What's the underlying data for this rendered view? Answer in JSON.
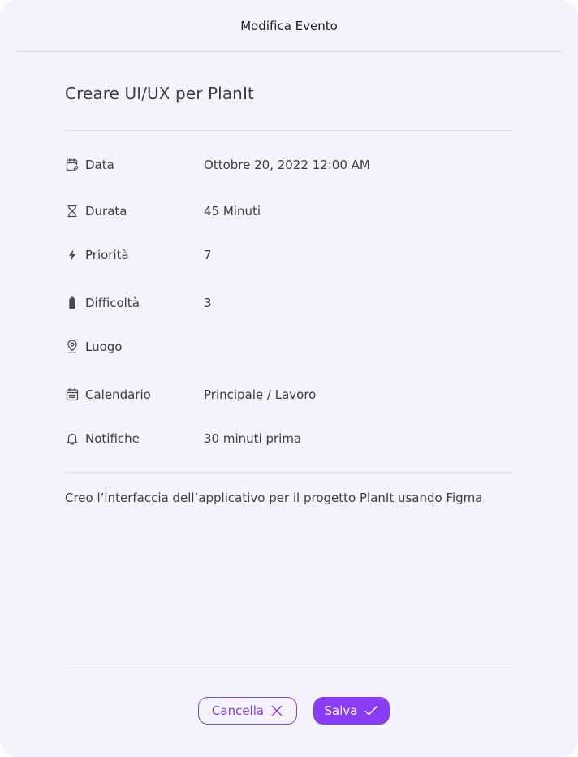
{
  "dialog": {
    "title": "Modifica Evento",
    "event_title": "Creare UI/UX per PlanIt",
    "description": "Creo l’interfaccia dell’applicativo per il progetto PlanIt usando Figma"
  },
  "fields": [
    {
      "icon": "calendar-edit-icon",
      "label": "Data",
      "value": "Ottobre 20, 2022 12:00 AM"
    },
    {
      "icon": "hourglass-icon",
      "label": "Durata",
      "value": "45 Minuti"
    },
    {
      "icon": "lightning-icon",
      "label": "Priorità",
      "value": "7"
    },
    {
      "icon": "battery-icon",
      "label": "Difficoltà",
      "value": "3"
    },
    {
      "icon": "location-pin-icon",
      "label": "Luogo",
      "value": ""
    },
    {
      "icon": "calendar-icon",
      "label": "Calendario",
      "value": "Principale / Lavoro"
    },
    {
      "icon": "bell-icon",
      "label": "Notifiche",
      "value": "30 minuti prima"
    }
  ],
  "buttons": {
    "cancel_label": "Cancella",
    "save_label": "Salva"
  },
  "colors": {
    "accent": "#8b3cf6",
    "background": "#f3f3fc"
  }
}
